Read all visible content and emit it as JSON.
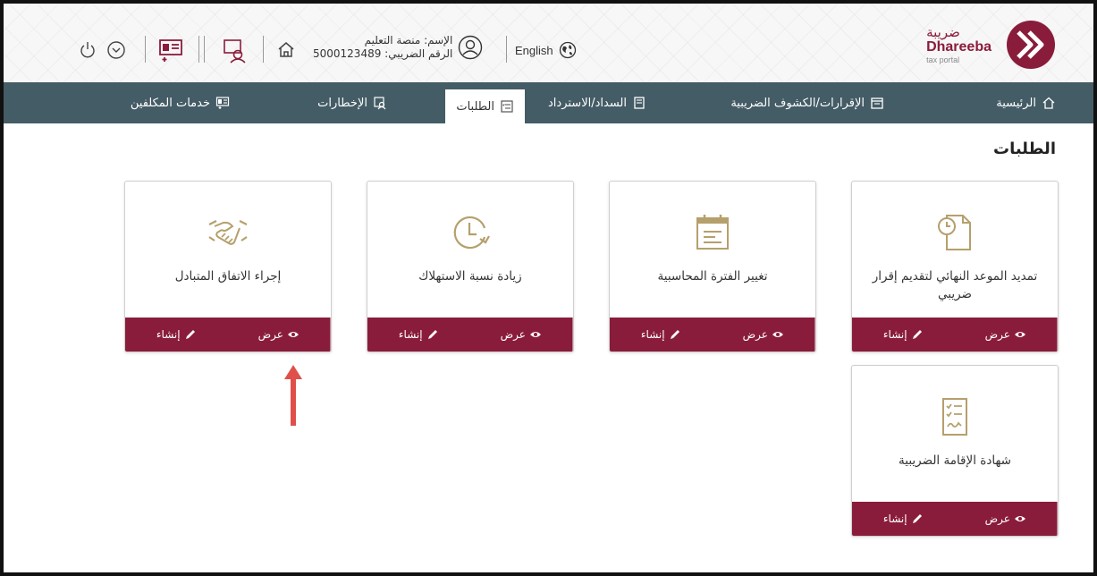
{
  "colors": {
    "brand": "#8a1c3b",
    "nav_bg": "#445c66",
    "gold": "#b5a06c",
    "arrow": "#e0504a"
  },
  "logo": {
    "arabic": "ضريبة",
    "english": "Dhareeba",
    "sub": "tax portal"
  },
  "header": {
    "language": "English",
    "user_name": "الإسم: منصة التعليم",
    "tax_number": "الرقم الضريبي: 5000123489",
    "icons": [
      "globe-icon",
      "user-avatar-icon",
      "home-icon",
      "profile-card-icon",
      "id-card-icon",
      "chevron-down-icon",
      "power-icon"
    ]
  },
  "nav": {
    "home": "الرئيسية",
    "returns": "الإقرارات/الكشوف الضريبية",
    "payments": "السداد/الاسترداد",
    "requests": "الطلبات",
    "notifications": "الإخطارات",
    "taxpayer_services": "خدمات المكلفين"
  },
  "page": {
    "title": "الطلبات"
  },
  "cards": [
    {
      "title": "تمديد الموعد النهائي لتقديم إقرار ضريبي",
      "icon": "document-clock-icon",
      "create": "إنشاء",
      "view": "عرض"
    },
    {
      "title": "تغيير الفترة المحاسبية",
      "icon": "calendar-icon",
      "create": "إنشاء",
      "view": "عرض"
    },
    {
      "title": "زيادة نسبة الاستهلاك",
      "icon": "clock-arrow-icon",
      "create": "إنشاء",
      "view": "عرض"
    },
    {
      "title": "إجراء الاتفاق المتبادل",
      "icon": "handshake-icon",
      "create": "إنشاء",
      "view": "عرض"
    },
    {
      "title": "شهادة الإقامة الضريبية",
      "icon": "checklist-certificate-icon",
      "create": "إنشاء",
      "view": "عرض"
    }
  ]
}
